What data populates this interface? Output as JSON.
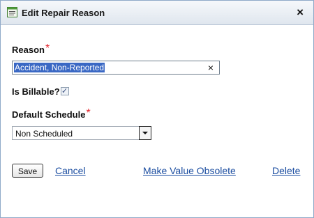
{
  "window": {
    "title": "Edit Repair Reason",
    "icon": "form-icon",
    "close_symbol": "×"
  },
  "form": {
    "reason": {
      "label": "Reason",
      "required_mark": "*",
      "value": "Accident, Non-Reported",
      "clear_symbol": "×"
    },
    "billable": {
      "label": "Is Billable?",
      "checked": true,
      "check_symbol": "✓"
    },
    "default_schedule": {
      "label": "Default Schedule",
      "required_mark": "*",
      "selected": "Non Scheduled"
    }
  },
  "actions": {
    "save_label": "Save",
    "cancel_label": "Cancel",
    "obsolete_label": "Make Value Obsolete",
    "delete_label": "Delete"
  },
  "colors": {
    "required": "#e3262e",
    "link": "#1b4da0",
    "selection": "#3a68c4",
    "border": "#8fa9c8"
  }
}
